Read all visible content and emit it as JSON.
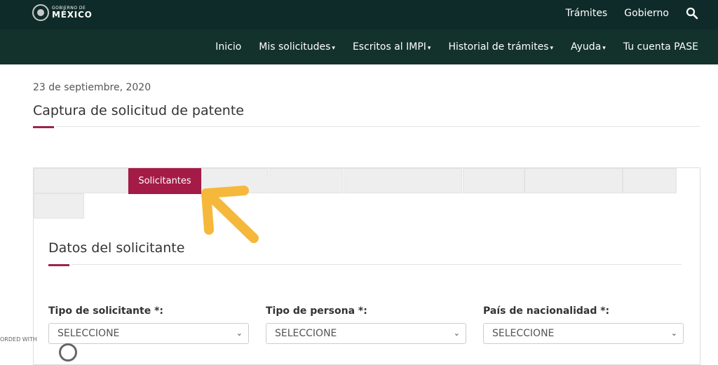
{
  "header": {
    "logo_line1": "GOBIERNO DE",
    "logo_line2": "MÉXICO",
    "top_links": [
      "Trámites",
      "Gobierno"
    ],
    "search_icon": "search-icon"
  },
  "nav": {
    "items": [
      {
        "label": "Inicio",
        "dropdown": false
      },
      {
        "label": "Mis solicitudes",
        "dropdown": true
      },
      {
        "label": "Escritos al IMPI",
        "dropdown": true
      },
      {
        "label": "Historial de trámites",
        "dropdown": true
      },
      {
        "label": "Ayuda",
        "dropdown": true
      },
      {
        "label": "Tu cuenta PASE",
        "dropdown": false
      }
    ],
    "caret": "▾"
  },
  "page": {
    "date": "23 de septiembre, 2020",
    "title": "Captura de solicitud de patente"
  },
  "tabs": {
    "active_label": "Solicitantes"
  },
  "section": {
    "title": "Datos del solicitante",
    "fields": [
      {
        "label": "Tipo de solicitante *:",
        "value": "SELECCIONE"
      },
      {
        "label": "Tipo de persona *:",
        "value": "SELECCIONE"
      },
      {
        "label": "País de nacionalidad *:",
        "value": "SELECCIONE"
      }
    ]
  },
  "watermark": "ORDED WITH",
  "colors": {
    "top_bar": "#0f2b29",
    "nav_bar": "#13322b",
    "accent": "#9d2449",
    "active_tab": "#a31b46",
    "arrow": "#f5b83a"
  }
}
